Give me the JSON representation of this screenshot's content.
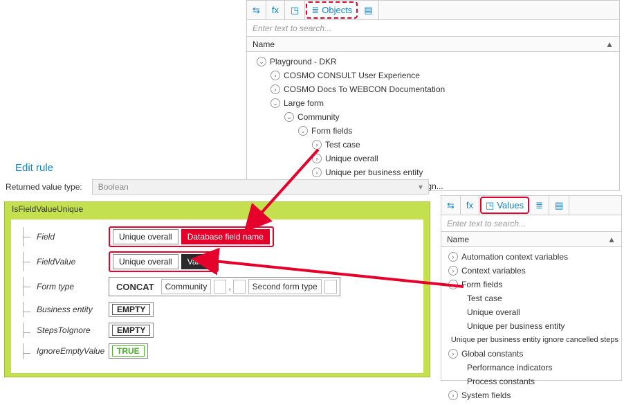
{
  "topTabs": {
    "t1": "⇆",
    "t2": "fx",
    "t3": "◳",
    "t4_icon": "≣",
    "t4_label": "Objects",
    "t5": "▤"
  },
  "searchPlaceholder": "Enter text to search...",
  "colName": "Name",
  "topTree": {
    "root": "Playground - DKR",
    "a": "COSMO CONSULT User Experience",
    "b": "COSMO Docs To WEBCON Documentation",
    "c": "Large form",
    "c1": "Community",
    "c1a": "Form fields",
    "c1a1": "Test case",
    "c1a2": "Unique overall",
    "c1a3": "Unique per business entity",
    "c1a4": "Unique per business entity ign..."
  },
  "editRuleTitle": "Edit rule",
  "returnedLabel": "Returned value type:",
  "returnedValue": "Boolean",
  "rule": {
    "name": "IsFieldValueUnique",
    "params": {
      "field": "Field",
      "fieldValue": "FieldValue",
      "formType": "Form type",
      "businessEntity": "Business entity",
      "stepsToIgnore": "StepsToIgnore",
      "ignoreEmpty": "IgnoreEmptyValue"
    },
    "fieldSlot": {
      "name": "Unique overall",
      "tag": "Database field name"
    },
    "fieldValueSlot": {
      "name": "Unique overall",
      "tag": "Value"
    },
    "formTypeSlot": {
      "op": "CONCAT",
      "first": "Community",
      "second": "Second form type"
    },
    "empty": "EMPTY",
    "true": "TRUE"
  },
  "rightTabs": {
    "t1": "⇆",
    "t2": "fx",
    "t3_icon": "◳",
    "t3_label": "Values",
    "t4": "≣",
    "t5": "▤"
  },
  "rightTree": {
    "a": "Automation context variables",
    "b": "Context variables",
    "c": "Form fields",
    "c1": "Test case",
    "c2": "Unique overall",
    "c3": "Unique per business entity",
    "c4": "Unique per business entity ignore cancelled steps",
    "d": "Global constants",
    "d1": "Performance indicators",
    "d2": "Process constants",
    "e": "System fields"
  }
}
